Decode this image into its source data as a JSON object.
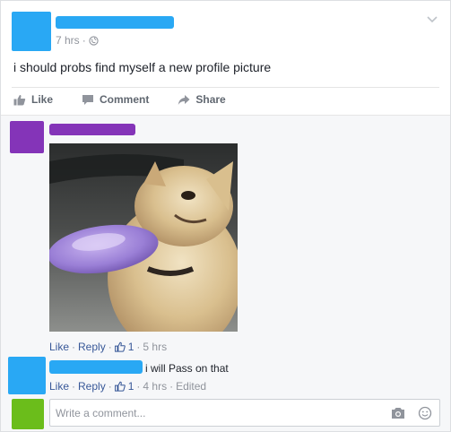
{
  "post": {
    "time": "7 hrs",
    "text": "i should probs find myself a new profile picture",
    "actions": {
      "like": "Like",
      "comment": "Comment",
      "share": "Share"
    }
  },
  "comments": [
    {
      "like": "Like",
      "reply": "Reply",
      "likes_count": "1",
      "time": "5 hrs"
    },
    {
      "text": "i will Pass on that",
      "like": "Like",
      "reply": "Reply",
      "likes_count": "1",
      "time": "4 hrs",
      "edited": "Edited"
    }
  ],
  "composer": {
    "placeholder": "Write a comment..."
  },
  "colors": {
    "redaction_blue": "#29a8f4",
    "redaction_purple": "#8434b8",
    "avatar_green": "#6bbd1b",
    "link": "#385898"
  },
  "icons": [
    "chevron-down-icon",
    "globe-icon",
    "thumbs-up-icon",
    "comment-icon",
    "share-icon",
    "camera-icon",
    "emoji-icon"
  ]
}
